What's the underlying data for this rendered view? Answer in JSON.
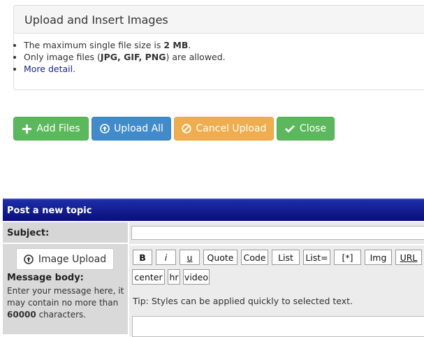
{
  "upload_panel": {
    "title": "Upload and Insert Images",
    "line1_prefix": "The maximum single file size is ",
    "line1_bold": "2 MB",
    "line1_suffix": ".",
    "line2_prefix": "Only image files (",
    "line2_bold": "JPG, GIF, PNG",
    "line2_suffix": ") are allowed.",
    "detail_link": "More detail",
    "detail_suffix": "."
  },
  "actions": {
    "add_files": "Add Files",
    "upload_all": "Upload All",
    "cancel_upload": "Cancel Upload",
    "close": "Close"
  },
  "post": {
    "header": "Post a new topic",
    "subject_label": "Subject:",
    "subject_value": "",
    "image_upload": "Image Upload",
    "message_label": "Message body:",
    "help_prefix": "Enter your message here, it may contain no more than ",
    "help_bold": "60000",
    "help_suffix": " characters.",
    "tip": "Tip: Styles can be applied quickly to selected text.",
    "toolbar": [
      "B",
      "i",
      "u",
      "Quote",
      "Code",
      "List",
      "List=",
      "[*]",
      "Img",
      "URL",
      "center",
      "hr",
      "video"
    ]
  },
  "colors": {
    "success": "#5cb85c",
    "primary": "#428bca",
    "warning": "#f0ad4e",
    "header_blue": "#0a0e7a"
  },
  "icons": {
    "add_files": "plus-icon",
    "upload_all": "upload-circle-icon",
    "cancel_upload": "ban-icon",
    "close": "check-icon",
    "image_upload": "upload-circle-icon"
  }
}
